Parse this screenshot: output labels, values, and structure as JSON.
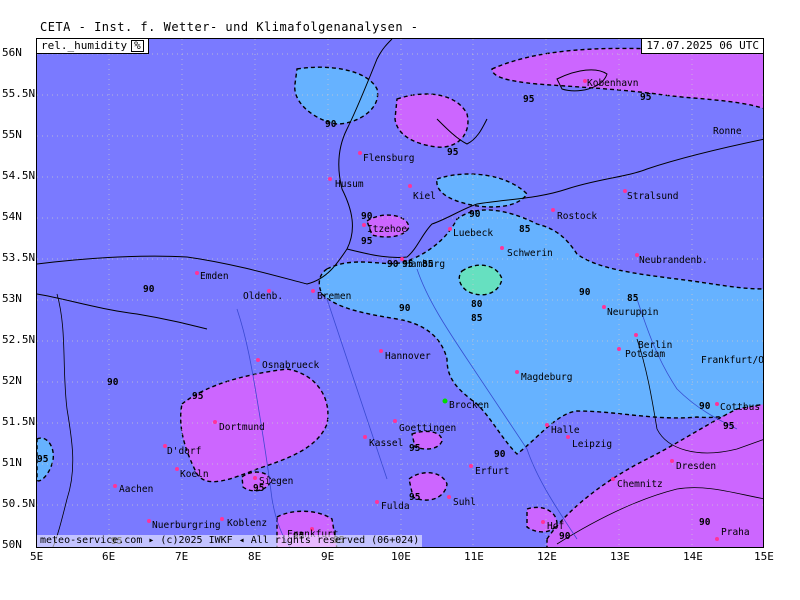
{
  "header": {
    "title": "CETA - Inst. f. Wetter- und Klimafolgenanalysen -"
  },
  "parameter": {
    "name": "rel._humidity",
    "unit": "%"
  },
  "datetime": "17.07.2025 06 UTC",
  "footer": {
    "text": "meteo-service.com ▸ (c)2025 IWKF ◂ All rights reserved (06+024)"
  },
  "axes": {
    "lat_labels": [
      "56N",
      "55.5N",
      "55N",
      "54.5N",
      "54N",
      "53.5N",
      "53N",
      "52.5N",
      "52N",
      "51.5N",
      "51N",
      "50.5N",
      "50N"
    ],
    "lon_labels": [
      "5E",
      "6E",
      "7E",
      "8E",
      "9E",
      "10E",
      "11E",
      "12E",
      "13E",
      "14E",
      "15E"
    ]
  },
  "cities": [
    {
      "name": "Kobenhavn"
    },
    {
      "name": "Ronne"
    },
    {
      "name": "Flensburg"
    },
    {
      "name": "Husum"
    },
    {
      "name": "Kiel"
    },
    {
      "name": "Rostock"
    },
    {
      "name": "Stralsund"
    },
    {
      "name": "Itzehoe"
    },
    {
      "name": "Luebeck"
    },
    {
      "name": "Schwerin"
    },
    {
      "name": "Hamburg"
    },
    {
      "name": "Neubrandenb."
    },
    {
      "name": "Emden"
    },
    {
      "name": "Oldenb."
    },
    {
      "name": "Bremen"
    },
    {
      "name": "Neuruppin"
    },
    {
      "name": "Berlin"
    },
    {
      "name": "Potsdam"
    },
    {
      "name": "Frankfurt/O"
    },
    {
      "name": "Osnabrueck"
    },
    {
      "name": "Hannover"
    },
    {
      "name": "Magdeburg"
    },
    {
      "name": "Cottbus"
    },
    {
      "name": "Brocken"
    },
    {
      "name": "Dortmund"
    },
    {
      "name": "Goettingen"
    },
    {
      "name": "Kassel"
    },
    {
      "name": "Halle"
    },
    {
      "name": "Leipzig"
    },
    {
      "name": "D'dorf"
    },
    {
      "name": "Koeln"
    },
    {
      "name": "Erfurt"
    },
    {
      "name": "Dresden"
    },
    {
      "name": "Siegen"
    },
    {
      "name": "Aachen"
    },
    {
      "name": "Chemnitz"
    },
    {
      "name": "Fulda"
    },
    {
      "name": "Suhl"
    },
    {
      "name": "Hof"
    },
    {
      "name": "Nuerburgring"
    },
    {
      "name": "Koblenz"
    },
    {
      "name": "Frankfurt"
    },
    {
      "name": "Praha"
    }
  ],
  "contour_labels": [
    "95",
    "95",
    "90",
    "95",
    "90",
    "95",
    "85",
    "90",
    "95",
    "85",
    "90",
    "80",
    "85",
    "90",
    "90",
    "85",
    "90",
    "95",
    "90",
    "95",
    "95",
    "90",
    "90",
    "95",
    "95",
    "90",
    "95",
    "95",
    "90",
    "95",
    "95"
  ],
  "colors": {
    "level_90": "#7a7aff",
    "level_95": "#cc66ff",
    "level_85": "#66b2ff",
    "level_80": "#66e0c0",
    "border": "#000000",
    "river": "#3344cc",
    "city_marker": "#ff3399",
    "brocken": "#00dd00"
  }
}
